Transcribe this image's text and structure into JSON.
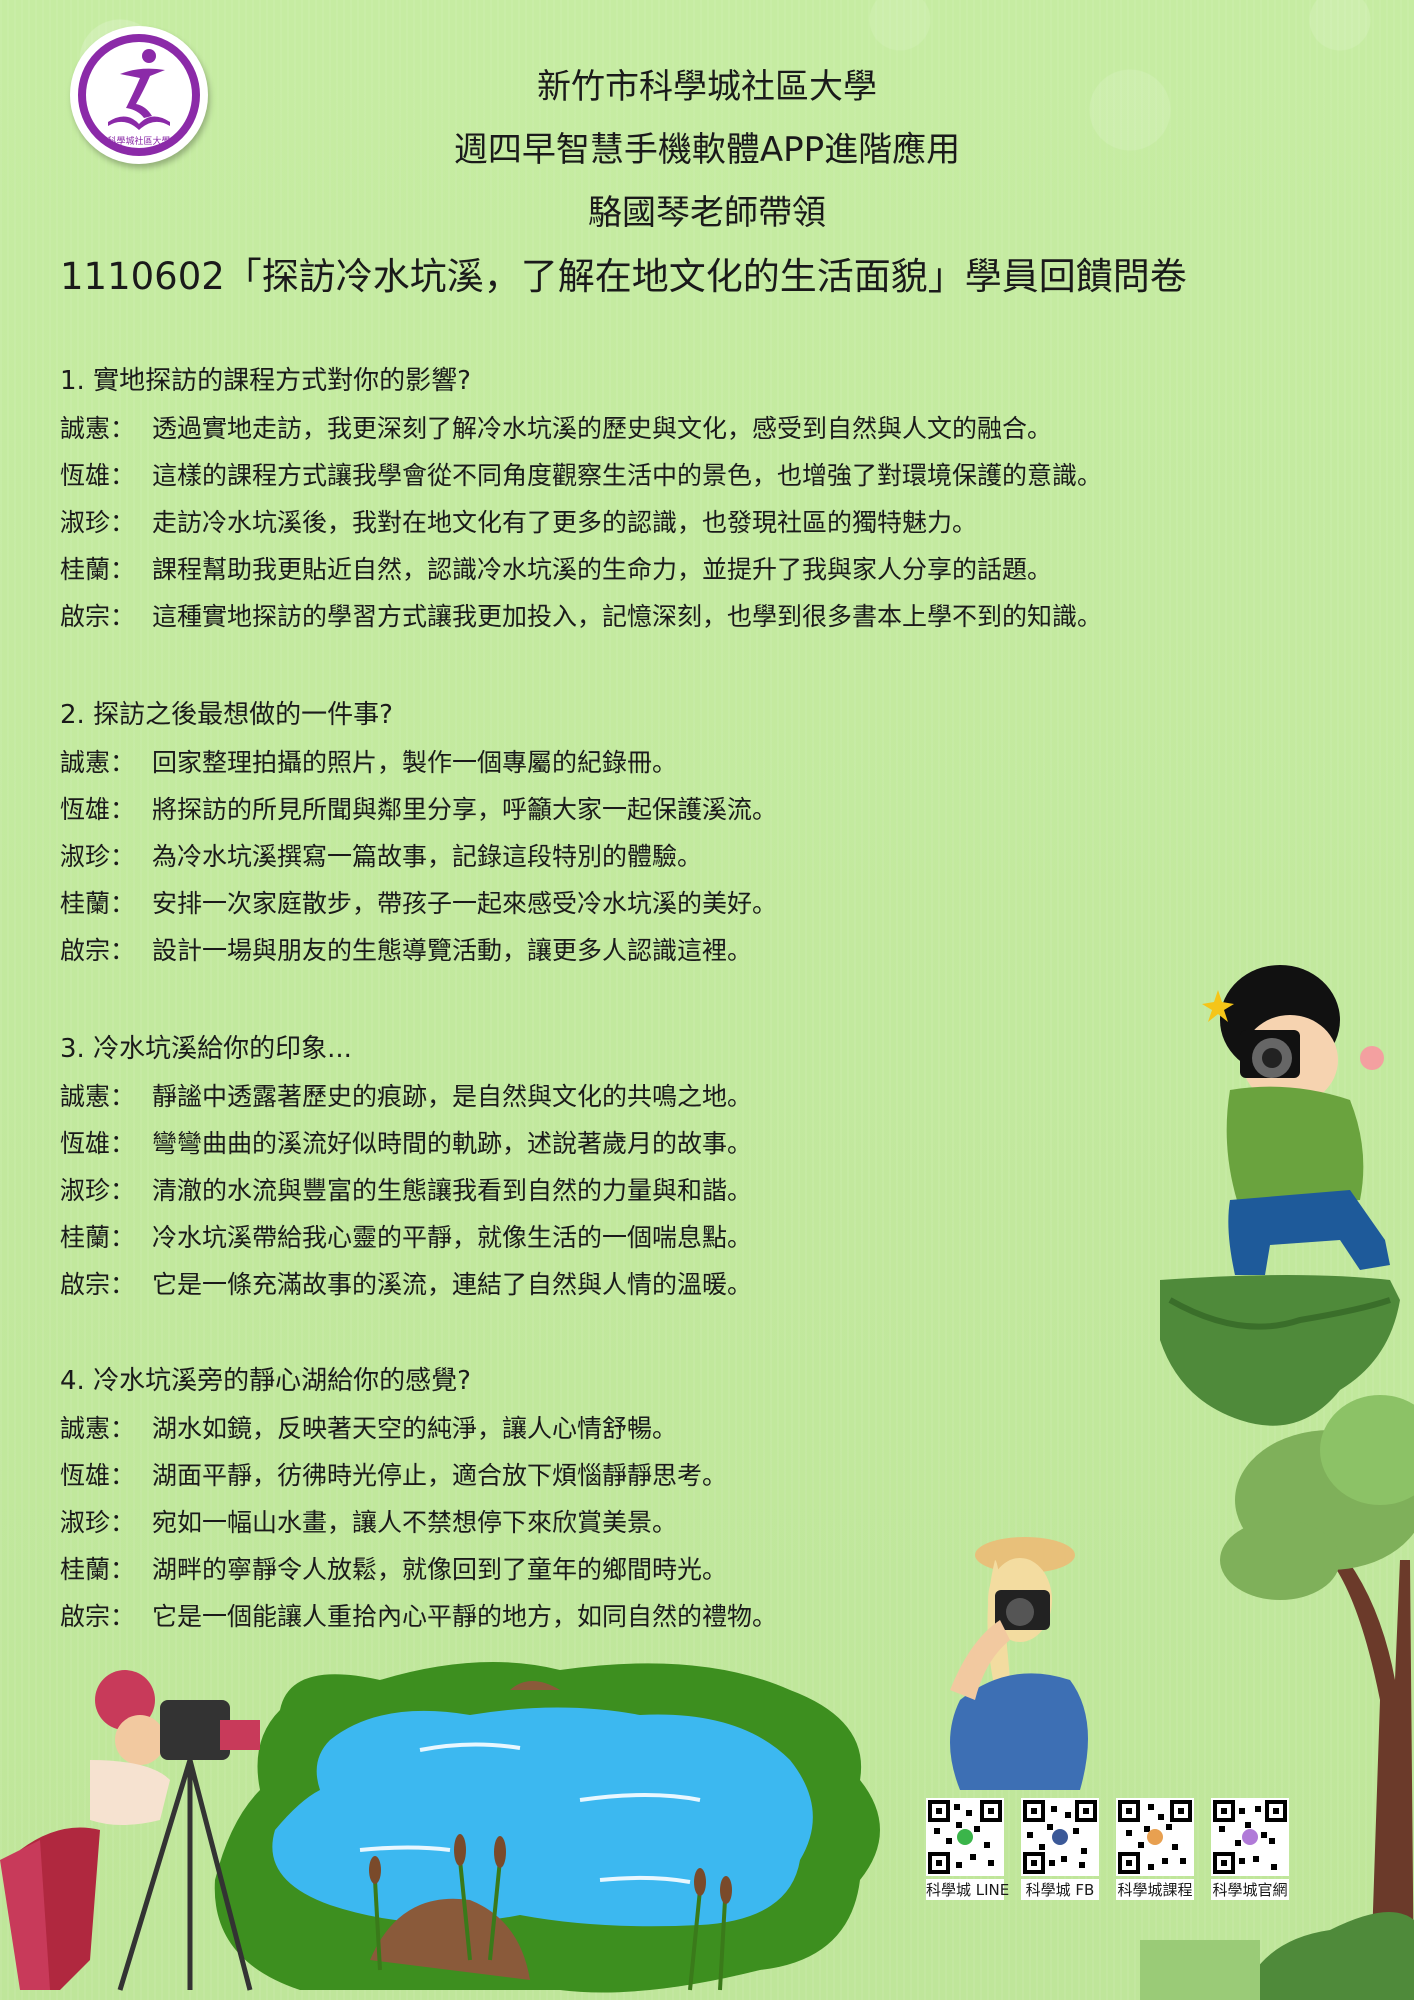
{
  "header": {
    "line1": "新竹市科學城社區大學",
    "line2": "週四早智慧手機軟體APP進階應用",
    "line3": "駱國琴老師帶領"
  },
  "title": "1110602「探訪冷水坑溪，了解在地文化的生活面貌」學員回饋問卷",
  "sections": [
    {
      "question": "1. 實地探訪的課程方式對你的影響?",
      "answers": [
        {
          "name": "誠憲：",
          "text": "透過實地走訪，我更深刻了解冷水坑溪的歷史與文化，感受到自然與人文的融合。"
        },
        {
          "name": "恆雄：",
          "text": "這樣的課程方式讓我學會從不同角度觀察生活中的景色，也增強了對環境保護的意識。"
        },
        {
          "name": "淑珍：",
          "text": "走訪冷水坑溪後，我對在地文化有了更多的認識，也發現社區的獨特魅力。"
        },
        {
          "name": "桂蘭：",
          "text": "課程幫助我更貼近自然，認識冷水坑溪的生命力，並提升了我與家人分享的話題。"
        },
        {
          "name": "啟宗：",
          "text": "這種實地探訪的學習方式讓我更加投入，記憶深刻，也學到很多書本上學不到的知識。"
        }
      ]
    },
    {
      "question": "2. 探訪之後最想做的一件事?",
      "answers": [
        {
          "name": "誠憲：",
          "text": "回家整理拍攝的照片，製作一個專屬的紀錄冊。"
        },
        {
          "name": "恆雄：",
          "text": "將探訪的所見所聞與鄰里分享，呼籲大家一起保護溪流。"
        },
        {
          "name": "淑珍：",
          "text": "為冷水坑溪撰寫一篇故事，記錄這段特別的體驗。"
        },
        {
          "name": "桂蘭：",
          "text": "安排一次家庭散步，帶孩子一起來感受冷水坑溪的美好。"
        },
        {
          "name": "啟宗：",
          "text": "設計一場與朋友的生態導覽活動，讓更多人認識這裡。"
        }
      ]
    },
    {
      "question": "3. 冷水坑溪給你的印象...",
      "answers": [
        {
          "name": "誠憲：",
          "text": "靜謐中透露著歷史的痕跡，是自然與文化的共鳴之地。"
        },
        {
          "name": "恆雄：",
          "text": "彎彎曲曲的溪流好似時間的軌跡，述說著歲月的故事。"
        },
        {
          "name": "淑珍：",
          "text": "清澈的水流與豐富的生態讓我看到自然的力量與和諧。"
        },
        {
          "name": "桂蘭：",
          "text": "冷水坑溪帶給我心靈的平靜，就像生活的一個喘息點。"
        },
        {
          "name": "啟宗：",
          "text": "它是一條充滿故事的溪流，連結了自然與人情的溫暖。"
        }
      ]
    },
    {
      "question": "4. 冷水坑溪旁的靜心湖給你的感覺?",
      "answers": [
        {
          "name": "誠憲：",
          "text": "湖水如鏡，反映著天空的純淨，讓人心情舒暢。"
        },
        {
          "name": "恆雄：",
          "text": "湖面平靜，彷彿時光停止，適合放下煩惱靜靜思考。"
        },
        {
          "name": "淑珍：",
          "text": "宛如一幅山水畫，讓人不禁想停下來欣賞美景。"
        },
        {
          "name": "桂蘭：",
          "text": "湖畔的寧靜令人放鬆，就像回到了童年的鄉間時光。"
        },
        {
          "name": "啟宗：",
          "text": "它是一個能讓人重拾內心平靜的地方，如同自然的禮物。"
        }
      ]
    }
  ],
  "qr_codes": [
    {
      "label": "科學城 LINE",
      "icon": "line-icon"
    },
    {
      "label": "科學城 FB",
      "icon": "facebook-icon"
    },
    {
      "label": "科學城課程",
      "icon": "book-icon"
    },
    {
      "label": "科學城官網",
      "icon": "globe-icon"
    }
  ],
  "logo": {
    "text": "科學城社區大學",
    "color": "#8b2aa8"
  }
}
